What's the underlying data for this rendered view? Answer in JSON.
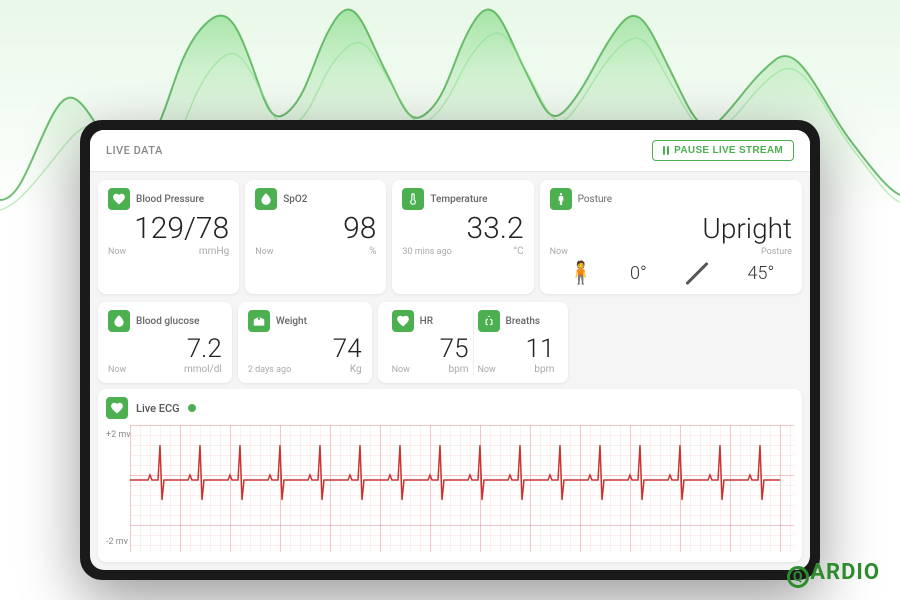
{
  "header": {
    "title": "LIVE DATA",
    "pause_button": "PAUSE LIVE STREAM"
  },
  "cards_row1": [
    {
      "id": "blood-pressure",
      "label": "Blood Pressure",
      "value": "129/78",
      "time": "Now",
      "unit": "mmHg",
      "icon": "heart-bp"
    },
    {
      "id": "spo2",
      "label": "SpO2",
      "value": "98",
      "time": "Now",
      "unit": "%",
      "icon": "droplet"
    },
    {
      "id": "temperature",
      "label": "Temperature",
      "value": "33.2",
      "time": "30 mins ago",
      "unit": "°C",
      "icon": "thermometer"
    },
    {
      "id": "posture",
      "label": "Posture",
      "value": "Upright",
      "time": "Now",
      "unit": "Posture",
      "angle1": "0°",
      "angle2": "45°"
    }
  ],
  "cards_row2": [
    {
      "id": "blood-glucose",
      "label": "Blood glucose",
      "value": "7.2",
      "time": "Now",
      "unit": "mmol/dl",
      "icon": "glucose"
    },
    {
      "id": "weight",
      "label": "Weight",
      "value": "74",
      "time": "2 days ago",
      "unit": "Kg",
      "icon": "weight"
    },
    {
      "id": "hr",
      "label": "HR",
      "value": "75",
      "time": "Now",
      "unit": "bpm",
      "icon": "heart"
    },
    {
      "id": "breaths",
      "label": "Breaths",
      "value": "11",
      "time": "Now",
      "unit": "bpm",
      "icon": "lungs"
    }
  ],
  "ecg": {
    "title": "Live ECG",
    "pos_label": "+2 mv",
    "neg_label": "-2 mv"
  },
  "brand": {
    "name": "QARDIO"
  }
}
